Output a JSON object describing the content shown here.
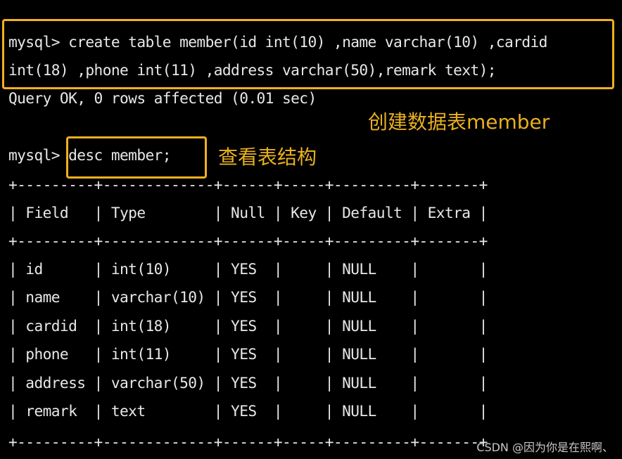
{
  "terminal": {
    "prompt": "mysql>",
    "create_command_line1": "create table member(id int(10) ,name varchar(10) ,cardid",
    "create_command_line2": "int(18) ,phone int(11) ,address varchar(50),remark text);",
    "query_result": "Query OK, 0 rows affected (0.01 sec)",
    "desc_command": "desc member;"
  },
  "annotations": {
    "create_label": "创建数据表member",
    "desc_label": "查看表结构"
  },
  "table": {
    "separator": "+---------+-------------+------+-----+---------+-------+",
    "columns": [
      "Field",
      "Type",
      "Null",
      "Key",
      "Default",
      "Extra"
    ],
    "header_line": "| Field   | Type        | Null | Key | Default | Extra |",
    "rows": [
      {
        "Field": "id",
        "Type": "int(10)",
        "Null": "YES",
        "Key": "",
        "Default": "NULL",
        "Extra": "",
        "line": "| id      | int(10)     | YES  |     | NULL    |       |"
      },
      {
        "Field": "name",
        "Type": "varchar(10)",
        "Null": "YES",
        "Key": "",
        "Default": "NULL",
        "Extra": "",
        "line": "| name    | varchar(10) | YES  |     | NULL    |       |"
      },
      {
        "Field": "cardid",
        "Type": "int(18)",
        "Null": "YES",
        "Key": "",
        "Default": "NULL",
        "Extra": "",
        "line": "| cardid  | int(18)     | YES  |     | NULL    |       |"
      },
      {
        "Field": "phone",
        "Type": "int(11)",
        "Null": "YES",
        "Key": "",
        "Default": "NULL",
        "Extra": "",
        "line": "| phone   | int(11)     | YES  |     | NULL    |       |"
      },
      {
        "Field": "address",
        "Type": "varchar(50)",
        "Null": "YES",
        "Key": "",
        "Default": "NULL",
        "Extra": "",
        "line": "| address | varchar(50) | YES  |     | NULL    |       |"
      },
      {
        "Field": "remark",
        "Type": "text",
        "Null": "YES",
        "Key": "",
        "Default": "NULL",
        "Extra": "",
        "line": "| remark  | text        | YES  |     | NULL    |       |"
      }
    ]
  },
  "watermark": "CSDN @因为你是在熙啊、",
  "colors": {
    "background": "#000000",
    "terminal_text": "#e8e8e8",
    "highlight": "#f2b01e",
    "annotation": "#e8b020"
  }
}
